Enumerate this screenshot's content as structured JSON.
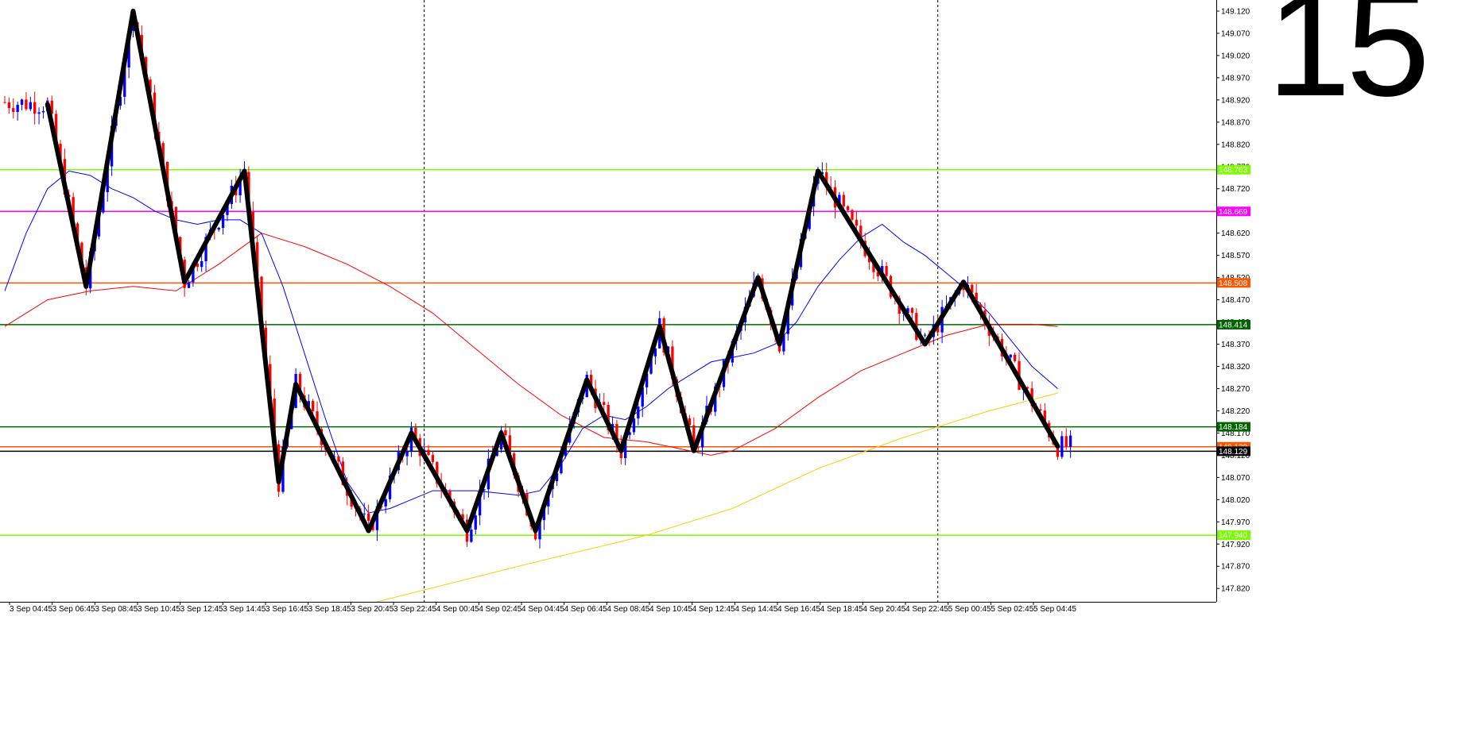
{
  "timeframe_label": "15",
  "colors": {
    "bull": "#0000ff",
    "bear": "#ff0000",
    "ma_fast": "#0000ff",
    "ma_slow": "#ff0000",
    "ma_long": "#ffcc00",
    "zigzag": "#000000",
    "grid": "#000000"
  },
  "chart_data": {
    "type": "candlestick",
    "ylim": [
      147.79,
      149.145
    ],
    "y_ticks": [
      "149.120",
      "149.070",
      "149.020",
      "148.970",
      "148.920",
      "148.870",
      "148.820",
      "148.770",
      "148.720",
      "148.670",
      "148.620",
      "148.570",
      "148.520",
      "148.470",
      "148.420",
      "148.370",
      "148.320",
      "148.270",
      "148.220",
      "148.170",
      "148.120",
      "148.070",
      "148.020",
      "147.970",
      "147.920",
      "147.870",
      "147.820"
    ],
    "x_labels": [
      "3 Sep 04:45",
      "3 Sep 06:45",
      "3 Sep 08:45",
      "3 Sep 10:45",
      "3 Sep 12:45",
      "3 Sep 14:45",
      "3 Sep 16:45",
      "3 Sep 18:45",
      "3 Sep 20:45",
      "3 Sep 22:45",
      "4 Sep 00:45",
      "4 Sep 02:45",
      "4 Sep 04:45",
      "4 Sep 06:45",
      "4 Sep 08:45",
      "4 Sep 10:45",
      "4 Sep 12:45",
      "4 Sep 14:45",
      "4 Sep 16:45",
      "4 Sep 18:45",
      "4 Sep 20:45",
      "4 Sep 22:45",
      "5 Sep 00:45",
      "5 Sep 02:45",
      "5 Sep 04:45"
    ],
    "bar_count": 250,
    "session_separators": [
      98,
      218
    ],
    "levels": [
      {
        "value": 148.763,
        "label": "148.763",
        "color": "#7cfc00"
      },
      {
        "value": 148.669,
        "label": "148.669",
        "color": "#ff00ff"
      },
      {
        "value": 148.508,
        "label": "148.508",
        "color": "#ff5500"
      },
      {
        "value": 148.414,
        "label": "148.414",
        "color": "#006400"
      },
      {
        "value": 148.184,
        "label": "148.184",
        "color": "#006400"
      },
      {
        "value": 148.139,
        "label": "148.139",
        "color": "#ff5500"
      },
      {
        "value": 148.129,
        "label": "148.129",
        "color": "#000000"
      },
      {
        "value": 147.94,
        "label": "147.940",
        "color": "#7cfc00"
      }
    ],
    "zigzag": [
      [
        10,
        148.91
      ],
      [
        19,
        148.5
      ],
      [
        30,
        149.12
      ],
      [
        42,
        148.51
      ],
      [
        56,
        148.76
      ],
      [
        64,
        148.06
      ],
      [
        68,
        148.28
      ],
      [
        85,
        147.95
      ],
      [
        95,
        148.17
      ],
      [
        108,
        147.95
      ],
      [
        116,
        148.17
      ],
      [
        124,
        147.95
      ],
      [
        136,
        148.29
      ],
      [
        144,
        148.13
      ],
      [
        153,
        148.41
      ],
      [
        161,
        148.13
      ],
      [
        176,
        148.52
      ],
      [
        181,
        148.37
      ],
      [
        190,
        148.76
      ],
      [
        215,
        148.37
      ],
      [
        224,
        148.51
      ],
      [
        246,
        148.14
      ]
    ],
    "ma_fast": [
      [
        0,
        148.49
      ],
      [
        5,
        148.62
      ],
      [
        10,
        148.72
      ],
      [
        15,
        148.76
      ],
      [
        20,
        148.75
      ],
      [
        25,
        148.72
      ],
      [
        30,
        148.7
      ],
      [
        35,
        148.67
      ],
      [
        40,
        148.65
      ],
      [
        45,
        148.64
      ],
      [
        50,
        148.65
      ],
      [
        55,
        148.65
      ],
      [
        60,
        148.62
      ],
      [
        65,
        148.5
      ],
      [
        70,
        148.35
      ],
      [
        75,
        148.2
      ],
      [
        80,
        148.06
      ],
      [
        85,
        147.99
      ],
      [
        90,
        148.0
      ],
      [
        95,
        148.02
      ],
      [
        100,
        148.04
      ],
      [
        110,
        148.04
      ],
      [
        120,
        148.03
      ],
      [
        125,
        148.04
      ],
      [
        130,
        148.1
      ],
      [
        135,
        148.18
      ],
      [
        140,
        148.21
      ],
      [
        145,
        148.2
      ],
      [
        150,
        148.23
      ],
      [
        155,
        148.27
      ],
      [
        160,
        148.3
      ],
      [
        165,
        148.33
      ],
      [
        170,
        148.34
      ],
      [
        175,
        148.35
      ],
      [
        180,
        148.37
      ],
      [
        185,
        148.42
      ],
      [
        190,
        148.5
      ],
      [
        195,
        148.56
      ],
      [
        200,
        148.61
      ],
      [
        205,
        148.64
      ],
      [
        210,
        148.6
      ],
      [
        215,
        148.57
      ],
      [
        220,
        148.53
      ],
      [
        225,
        148.49
      ],
      [
        230,
        148.44
      ],
      [
        235,
        148.38
      ],
      [
        240,
        148.32
      ],
      [
        246,
        148.27
      ]
    ],
    "ma_slow": [
      [
        0,
        148.41
      ],
      [
        10,
        148.47
      ],
      [
        20,
        148.49
      ],
      [
        30,
        148.5
      ],
      [
        40,
        148.49
      ],
      [
        50,
        148.55
      ],
      [
        60,
        148.62
      ],
      [
        70,
        148.59
      ],
      [
        80,
        148.55
      ],
      [
        90,
        148.5
      ],
      [
        100,
        148.44
      ],
      [
        110,
        148.36
      ],
      [
        120,
        148.28
      ],
      [
        130,
        148.21
      ],
      [
        140,
        148.16
      ],
      [
        150,
        148.15
      ],
      [
        160,
        148.13
      ],
      [
        165,
        148.12
      ],
      [
        170,
        148.13
      ],
      [
        180,
        148.18
      ],
      [
        190,
        148.25
      ],
      [
        200,
        148.31
      ],
      [
        210,
        148.35
      ],
      [
        220,
        148.39
      ],
      [
        230,
        148.415
      ],
      [
        240,
        148.415
      ],
      [
        246,
        148.41
      ]
    ],
    "ma_long": [
      [
        87,
        147.79
      ],
      [
        120,
        147.87
      ],
      [
        150,
        147.94
      ],
      [
        170,
        148.0
      ],
      [
        190,
        148.09
      ],
      [
        210,
        148.16
      ],
      [
        230,
        148.22
      ],
      [
        246,
        148.26
      ]
    ]
  }
}
